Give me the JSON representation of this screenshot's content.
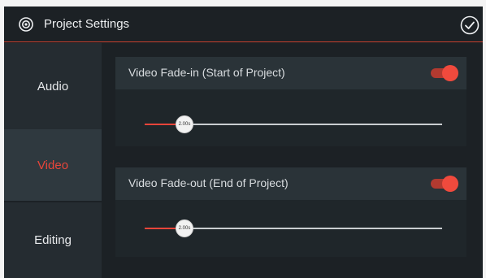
{
  "header": {
    "title": "Project Settings"
  },
  "sidebar": {
    "items": [
      {
        "label": "Audio",
        "active": false
      },
      {
        "label": "Video",
        "active": true
      },
      {
        "label": "Editing",
        "active": false
      }
    ]
  },
  "settings": [
    {
      "label": "Video Fade-in (Start of Project)",
      "enabled": true,
      "slider": {
        "value_label": "2.00s",
        "fraction": 0.14
      }
    },
    {
      "label": "Video Fade-out (End of Project)",
      "enabled": true,
      "slider": {
        "value_label": "2.00s",
        "fraction": 0.14
      }
    }
  ],
  "colors": {
    "accent": "#e8453a",
    "background": "#1c2125",
    "panel": "#2a3338",
    "sidebar": "#252c31",
    "sidebar_active": "#2f393f"
  },
  "icons": {
    "header_left": "settings-circle-icon",
    "header_right": "check-circle-icon"
  }
}
